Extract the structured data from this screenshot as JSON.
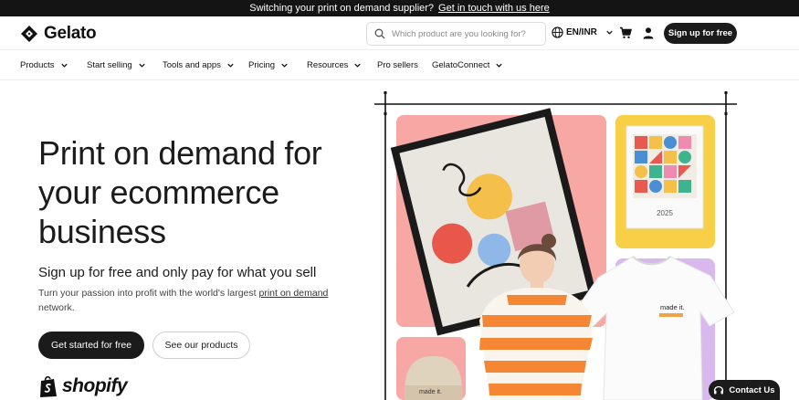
{
  "banner": {
    "text": "Switching your print on demand supplier?",
    "link": "Get in touch with us here"
  },
  "header": {
    "brand": "Gelato",
    "search_placeholder": "Which product are you looking for?",
    "language": "EN/INR",
    "signup_label": "Sign up for free"
  },
  "nav": {
    "items": [
      {
        "label": "Products",
        "has_dropdown": true
      },
      {
        "label": "Start selling",
        "has_dropdown": true
      },
      {
        "label": "Tools and apps",
        "has_dropdown": true
      },
      {
        "label": "Pricing",
        "has_dropdown": true
      },
      {
        "label": "Resources",
        "has_dropdown": true
      },
      {
        "label": "Pro sellers",
        "has_dropdown": false
      },
      {
        "label": "GelatoConnect",
        "has_dropdown": true
      }
    ]
  },
  "hero": {
    "title": "Print on demand for your ecommerce business",
    "subtitle": "Sign up for free and only pay for what you sell",
    "description_pre": "Turn your passion into profit with the world's largest ",
    "description_link": "print on demand",
    "description_post": " network.",
    "primary_cta": "Get started for free",
    "secondary_cta": "See our products",
    "partner": "shopify"
  },
  "products": {
    "calendar_year": "2025",
    "tshirt_print": "made it.",
    "beanie_print": "made it."
  },
  "contact_label": "Contact Us",
  "icons": [
    "gelato-logo-icon",
    "search-icon",
    "globe-icon",
    "chevron-down-icon",
    "cart-icon",
    "user-icon",
    "shopify-bag-icon",
    "headset-icon"
  ],
  "colors": {
    "accent": "#1b1b1b",
    "tile_pink": "#f7a8a4",
    "tile_yellow": "#f7d047",
    "tile_lilac": "#d9b8ee"
  }
}
